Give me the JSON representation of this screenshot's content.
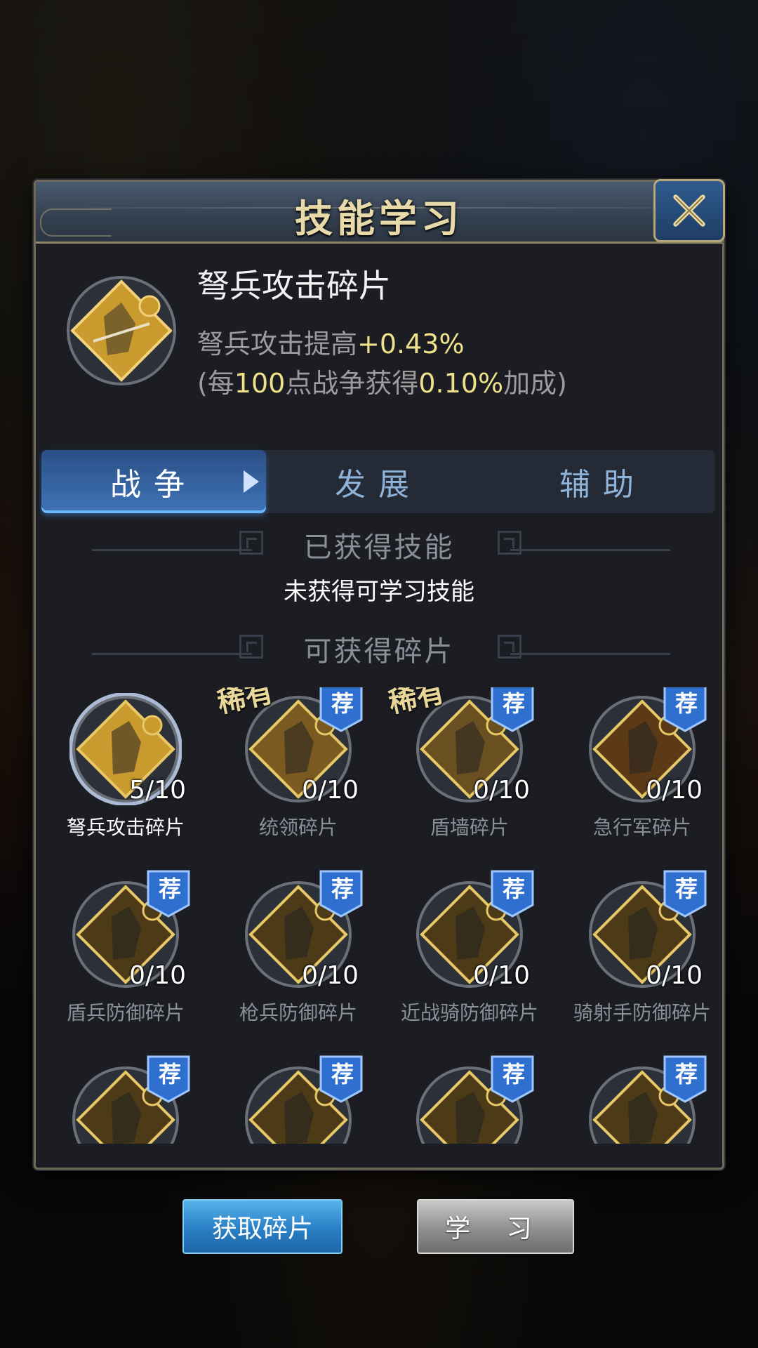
{
  "dialog": {
    "title": "技能学习"
  },
  "header": {
    "fragment_name": "弩兵攻击碎片",
    "desc_line1_prefix": "弩兵攻击提高",
    "desc_line1_value": "+0.43%",
    "desc_line2_a": "(每",
    "desc_line2_b": "100",
    "desc_line2_c": "点战争获得",
    "desc_line2_d": "0.10%",
    "desc_line2_e": "加成)"
  },
  "tabs": [
    {
      "label": "战争",
      "active": true
    },
    {
      "label": "发展",
      "active": false
    },
    {
      "label": "辅助",
      "active": false
    }
  ],
  "sections": {
    "acquired_title": "已获得技能",
    "acquired_empty": "未获得可学习技能",
    "obtainable_title": "可获得碎片"
  },
  "badges": {
    "recommend": "荐",
    "rare": "稀有"
  },
  "fragments": [
    {
      "name": "弩兵攻击碎片",
      "count": "5/10",
      "selected": true,
      "rare": false,
      "recommended": false,
      "color": "#c99a2e"
    },
    {
      "name": "统领碎片",
      "count": "0/10",
      "selected": false,
      "rare": true,
      "recommended": true,
      "color": "#7a5a20"
    },
    {
      "name": "盾墙碎片",
      "count": "0/10",
      "selected": false,
      "rare": true,
      "recommended": true,
      "color": "#6a5020"
    },
    {
      "name": "急行军碎片",
      "count": "0/10",
      "selected": false,
      "rare": false,
      "recommended": true,
      "color": "#5c3a18"
    },
    {
      "name": "盾兵防御碎片",
      "count": "0/10",
      "selected": false,
      "rare": false,
      "recommended": true,
      "color": "#4d3a16"
    },
    {
      "name": "枪兵防御碎片",
      "count": "0/10",
      "selected": false,
      "rare": false,
      "recommended": true,
      "color": "#4d3a16"
    },
    {
      "name": "近战骑防御碎片",
      "count": "0/10",
      "selected": false,
      "rare": false,
      "recommended": true,
      "color": "#4d3a16"
    },
    {
      "name": "骑射手防御碎片",
      "count": "0/10",
      "selected": false,
      "rare": false,
      "recommended": true,
      "color": "#4d3a16"
    },
    {
      "name": "",
      "count": "",
      "selected": false,
      "rare": false,
      "recommended": true,
      "color": "#4d3a16"
    },
    {
      "name": "",
      "count": "",
      "selected": false,
      "rare": false,
      "recommended": true,
      "color": "#4d3a16"
    },
    {
      "name": "",
      "count": "",
      "selected": false,
      "rare": false,
      "recommended": true,
      "color": "#4d3a16"
    },
    {
      "name": "",
      "count": "",
      "selected": false,
      "rare": false,
      "recommended": true,
      "color": "#4d3a16"
    }
  ],
  "buttons": {
    "get_fragments": "获取碎片",
    "learn": "学 习"
  }
}
